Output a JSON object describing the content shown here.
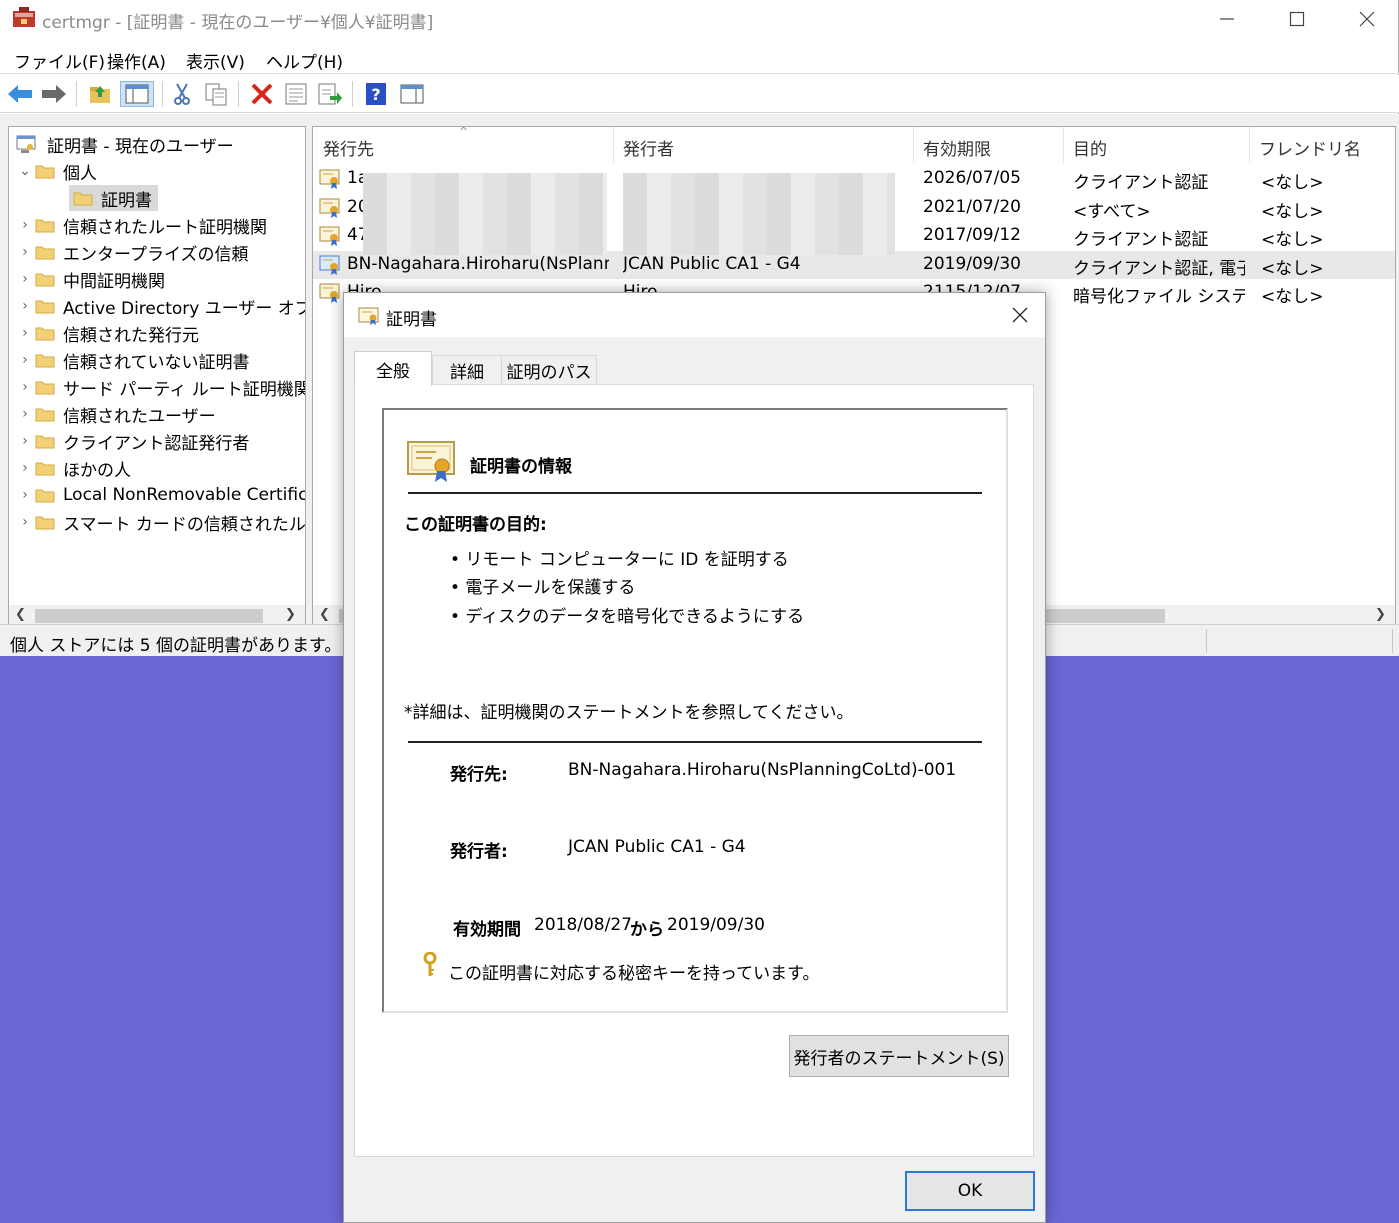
{
  "window": {
    "title": "certmgr - [証明書 - 現在のユーザー¥個人¥証明書]"
  },
  "menu": [
    "ファイル(F)",
    "操作(A)",
    "表示(V)",
    "ヘルプ(H)"
  ],
  "tree": {
    "root": "証明書 - 現在のユーザー",
    "personal": "個人",
    "selected": "証明書",
    "items": [
      "信頼されたルート証明機関",
      "エンタープライズの信頼",
      "中間証明機関",
      "Active Directory ユーザー オブジェクト",
      "信頼された発行元",
      "信頼されていない証明書",
      "サード パーティ ルート証明機関",
      "信頼されたユーザー",
      "クライアント認証発行者",
      "ほかの人",
      "Local NonRemovable Certificates",
      "スマート カードの信頼されたルート"
    ]
  },
  "list": {
    "columns": [
      "発行先",
      "発行者",
      "有効期限",
      "目的",
      "フレンドリ名"
    ],
    "rows": [
      {
        "to": "1a",
        "by": "",
        "expires": "2026/07/05",
        "purpose": "クライアント認証",
        "friendly": "<なし>"
      },
      {
        "to": "20",
        "by": "",
        "expires": "2021/07/20",
        "purpose": "<すべて>",
        "friendly": "<なし>"
      },
      {
        "to": "47",
        "by": "",
        "expires": "2017/09/12",
        "purpose": "クライアント認証",
        "friendly": "<なし>"
      },
      {
        "to": "BN-Nagahara.Hiroharu(NsPlann...",
        "by": "JCAN Public CA1 - G4",
        "expires": "2019/09/30",
        "purpose": "クライアント認証, 電子...",
        "friendly": "<なし>"
      },
      {
        "to": "Hiro",
        "by": "Hiro",
        "expires": "2115/12/07",
        "purpose": "暗号化ファイル システム",
        "friendly": "<なし>"
      }
    ]
  },
  "status": "個人 ストアには 5 個の証明書があります。",
  "dialog": {
    "title": "証明書",
    "tabs": [
      "全般",
      "詳細",
      "証明のパス"
    ],
    "info_heading": "証明書の情報",
    "purpose_heading": "この証明書の目的:",
    "purposes": [
      "• リモート コンピューターに ID を証明する",
      "• 電子メールを保護する",
      "• ディスクのデータを暗号化できるようにする"
    ],
    "detail_note": "*詳細は、証明機関のステートメントを参照してください。",
    "issued_to_label": "発行先:",
    "issued_to": "BN-Nagahara.Hiroharu(NsPlanningCoLtd)-001",
    "issued_by_label": "発行者:",
    "issued_by": "JCAN Public CA1 - G4",
    "validity_label": "有効期間",
    "valid_from": "2018/08/27",
    "valid_sep": "から",
    "valid_to": "2019/09/30",
    "key_note": "この証明書に対応する秘密キーを持っています。",
    "issuer_statement_btn": "発行者のステートメント(S)",
    "ok_btn": "OK"
  }
}
